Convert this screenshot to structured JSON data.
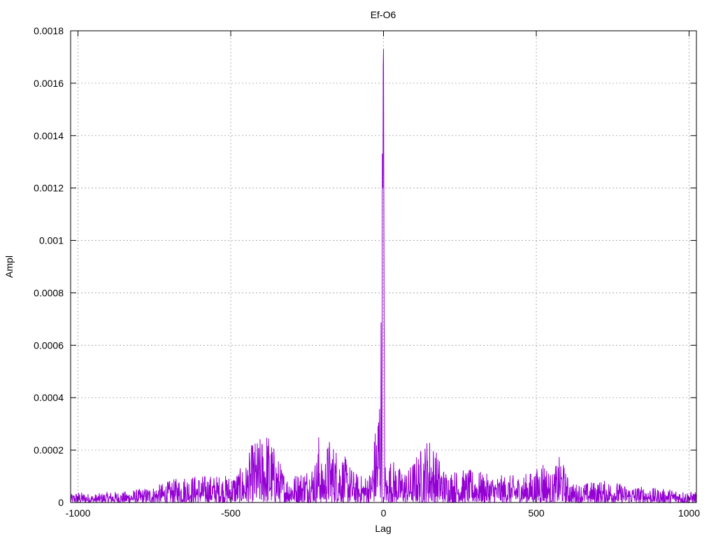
{
  "chart_data": {
    "type": "line",
    "title": "Ef-O6",
    "xlabel": "Lag",
    "ylabel": "Ampl",
    "xlim": [
      -1024,
      1024
    ],
    "ylim": [
      0,
      0.0018
    ],
    "x_ticks": [
      -1000,
      -500,
      0,
      500,
      1000
    ],
    "x_tick_labels": [
      "-1000",
      "-500",
      "0",
      "500",
      "1000"
    ],
    "y_ticks": [
      0,
      0.0002,
      0.0004,
      0.0006,
      0.0008,
      0.001,
      0.0012,
      0.0014,
      0.0016,
      0.0018
    ],
    "y_tick_labels": [
      "0",
      "0.0002",
      "0.0004",
      "0.0006",
      "0.0008",
      "0.001",
      "0.0012",
      "0.0014",
      "0.0016",
      "0.0018"
    ],
    "grid": true,
    "legend": "none",
    "series": [
      {
        "color": "#9400d3",
        "x": [
          -1024,
          -1000,
          -950,
          -900,
          -850,
          -800,
          -750,
          -700,
          -650,
          -600,
          -550,
          -500,
          -450,
          -430,
          -400,
          -380,
          -350,
          -320,
          -300,
          -250,
          -220,
          -210,
          -200,
          -180,
          -150,
          -120,
          -100,
          -80,
          -60,
          -40,
          -30,
          -20,
          -15,
          -10,
          -8,
          -6,
          -4,
          -2,
          -1,
          0,
          1,
          2,
          4,
          6,
          10,
          15,
          20,
          30,
          50,
          80,
          100,
          150,
          200,
          250,
          300,
          350,
          400,
          450,
          500,
          520,
          550,
          580,
          600,
          620,
          650,
          700,
          750,
          800,
          850,
          900,
          950,
          1000,
          1024
        ],
        "y": [
          3e-05,
          4e-05,
          3e-05,
          4e-05,
          4e-05,
          5e-05,
          6e-05,
          8e-05,
          0.0001,
          0.0001,
          0.0001,
          0.0001,
          0.00014,
          0.00022,
          0.00024,
          0.00027,
          0.00018,
          0.0001,
          0.0001,
          0.00013,
          0.00016,
          0.00028,
          0.00012,
          0.00024,
          0.0002,
          0.00016,
          0.00012,
          0.0001,
          0.0001,
          0.00012,
          0.00025,
          0.00033,
          0.00045,
          0.0006,
          0.00077,
          0.00095,
          0.00142,
          0.0012,
          0.00167,
          0.00173,
          0.0012,
          0.0007,
          0.0003,
          0.00015,
          0.0001,
          0.00012,
          0.00016,
          0.00016,
          0.00013,
          0.00012,
          0.00016,
          0.00025,
          0.00012,
          0.00012,
          0.00012,
          0.0001,
          0.0001,
          0.0001,
          0.00012,
          0.00017,
          0.0001,
          0.00018,
          0.0001,
          7e-05,
          7e-05,
          8e-05,
          8e-05,
          6e-05,
          6e-05,
          5e-05,
          5e-05,
          4e-05,
          4e-05
        ]
      }
    ]
  }
}
